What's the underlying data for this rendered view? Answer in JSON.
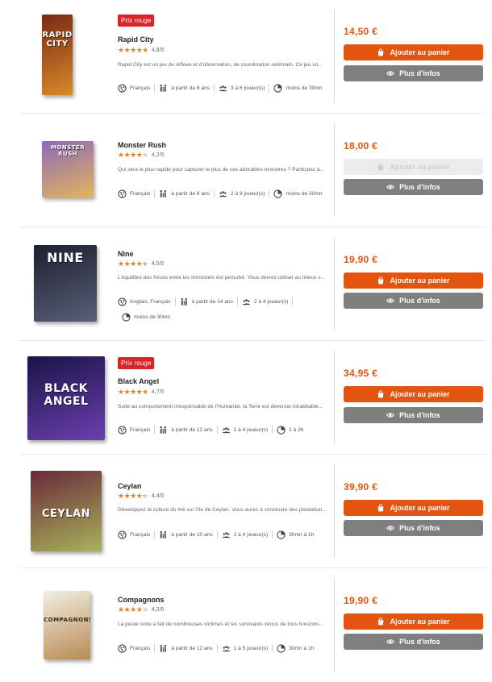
{
  "products": [
    {
      "name": "Rapid City",
      "badge": "Prix rouge",
      "rating": 4.8,
      "rating_text": "4,8/5",
      "description": "Rapid City est un jeu de réflexe et d'observation, de coordination oeil/main. Ce jeu vo...",
      "attributes": [
        "Français",
        "à partir de 8 ans",
        "3 à 6 joueur(s)",
        "moins de 30mn"
      ],
      "price": "14,50 €",
      "cart_label": "Ajouter au panier",
      "cart_disabled": false,
      "info_label": "Plus d'infos",
      "box_title": "RAPID CITY",
      "box_colors": [
        "#7a2a12",
        "#d7892a"
      ]
    },
    {
      "name": "Monster Rush",
      "badge": "",
      "rating": 4.2,
      "rating_text": "4,2/5",
      "description": "Qui sera le plus rapide pour capturer le plus de ces adorables monstres ? Participez à...",
      "attributes": [
        "Français",
        "à partir de 8 ans",
        "2 à 8 joueur(s)",
        "moins de 30mn"
      ],
      "price": "18,00 €",
      "cart_label": "Ajouter au panier",
      "cart_disabled": true,
      "info_label": "Plus d'infos",
      "box_title": "MONSTER RUSH",
      "box_colors": [
        "#8c6ab8",
        "#e4b45a"
      ]
    },
    {
      "name": "Nine",
      "badge": "",
      "rating": 4.5,
      "rating_text": "4,5/5",
      "description": "L'équilibre des forces entre les Immortels est perturbé. Vous devrez utiliser au mieux v...",
      "attributes": [
        "Anglais, Français",
        "à partir de 14 ans",
        "2 à 4 joueur(s)",
        "moins de 30mn"
      ],
      "price": "19,90 €",
      "cart_label": "Ajouter au panier",
      "cart_disabled": false,
      "info_label": "Plus d'infos",
      "box_title": "NINE",
      "box_colors": [
        "#1d2030",
        "#5a5f78"
      ]
    },
    {
      "name": "Black Angel",
      "badge": "Prix rouge",
      "rating": 4.7,
      "rating_text": "4,7/5",
      "description": "Suite au comportement irresponsable de l'Humanité, la Terre est devenue inhabitable...",
      "attributes": [
        "Français",
        "à partir de 12 ans",
        "1 à 4 joueur(s)",
        "1 à 2h"
      ],
      "price": "34,95 €",
      "cart_label": "Ajouter au panier",
      "cart_disabled": false,
      "info_label": "Plus d'infos",
      "box_title": "BLACK ANGEL",
      "box_colors": [
        "#1a1446",
        "#6c3fb0"
      ]
    },
    {
      "name": "Ceylan",
      "badge": "",
      "rating": 4.4,
      "rating_text": "4,4/5",
      "description": "Développez la culture du thé sur l'île de Ceylan. Vous aurez à construire des plantation...",
      "attributes": [
        "Français",
        "à partir de 10 ans",
        "2 à 4 joueur(s)",
        "30mn à 1h"
      ],
      "price": "39,90 €",
      "cart_label": "Ajouter au panier",
      "cart_disabled": false,
      "info_label": "Plus d'infos",
      "box_title": "CEYLAN",
      "box_colors": [
        "#6a2a3a",
        "#a7b35a"
      ]
    },
    {
      "name": "Compagnons",
      "badge": "",
      "rating": 4.2,
      "rating_text": "4,2/5",
      "description": "La peste noire a fait de nombreuses victimes et les survivants venus de tous horizons...",
      "attributes": [
        "Français",
        "à partir de 12 ans",
        "1 à 5 joueur(s)",
        "30mn à 1h"
      ],
      "price": "19,90 €",
      "cart_label": "Ajouter au panier",
      "cart_disabled": false,
      "info_label": "Plus d'infos",
      "box_title": "COMPAGNONS",
      "box_colors": [
        "#f2efe4",
        "#b98a52"
      ]
    }
  ],
  "icons": {
    "language": "globe-icon",
    "age": "family-icon",
    "players": "players-icon",
    "duration": "clock-icon",
    "cart": "shopping-bag-icon",
    "info": "eye-icon"
  },
  "colors": {
    "accent": "#e35411",
    "badge": "#d9252a",
    "star": "#e8831d",
    "info_button": "#7f7f7f"
  }
}
